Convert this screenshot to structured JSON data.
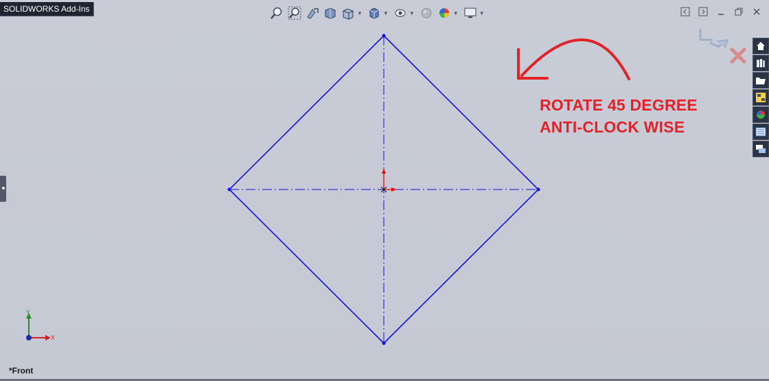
{
  "tab": {
    "label": "SOLIDWORKS Add-Ins"
  },
  "heads_up_toolbar": {
    "icons": [
      "zoom-to-fit-icon",
      "zoom-to-area-icon",
      "previous-view-icon",
      "section-view-icon",
      "view-orientation-icon",
      "display-style-icon",
      "hide-show-items-icon",
      "edit-appearance-icon",
      "apply-scene-icon",
      "view-settings-icon"
    ]
  },
  "window": {
    "controls": [
      "tile-left-icon",
      "tile-right-icon",
      "minimize-icon",
      "restore-icon",
      "close-icon"
    ]
  },
  "task_pane": {
    "tabs": [
      "home-icon",
      "design-library-icon",
      "file-explorer-icon",
      "view-palette-icon",
      "appearances-icon",
      "custom-properties-icon",
      "forum-icon"
    ]
  },
  "annotation": {
    "line1": "ROTATE 45 DEGREE",
    "line2": "ANTI-CLOCK WISE",
    "color": "#e32228"
  },
  "view": {
    "name": "*Front"
  },
  "triad": {
    "x_label": "X",
    "y_label": "Y"
  },
  "colors": {
    "sketch": "#1010e6",
    "origin": "#e01010"
  }
}
